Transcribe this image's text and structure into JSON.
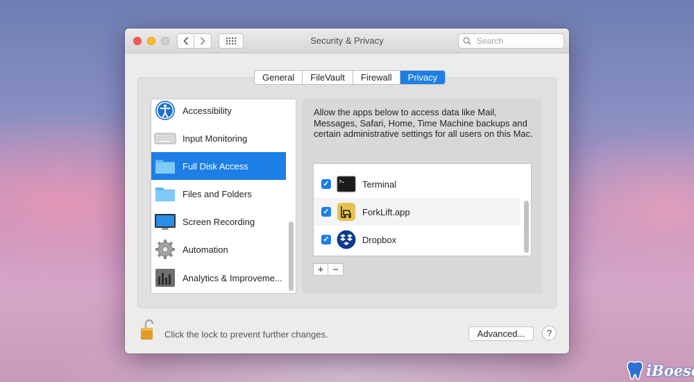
{
  "window": {
    "title": "Security & Privacy",
    "search_placeholder": "Search"
  },
  "tabs": [
    {
      "label": "General",
      "active": false
    },
    {
      "label": "FileVault",
      "active": false
    },
    {
      "label": "Firewall",
      "active": false
    },
    {
      "label": "Privacy",
      "active": true
    }
  ],
  "categories": [
    {
      "label": "Accessibility",
      "icon": "accessibility-icon"
    },
    {
      "label": "Input Monitoring",
      "icon": "keyboard-icon"
    },
    {
      "label": "Full Disk Access",
      "icon": "folder-icon",
      "selected": true
    },
    {
      "label": "Files and Folders",
      "icon": "folder-icon"
    },
    {
      "label": "Screen Recording",
      "icon": "display-icon"
    },
    {
      "label": "Automation",
      "icon": "gear-icon"
    },
    {
      "label": "Analytics & Improveme...",
      "icon": "analytics-icon"
    }
  ],
  "description": "Allow the apps below to access data like Mail, Messages, Safari, Home, Time Machine backups and certain administrative settings for all users on this Mac.",
  "apps": [
    {
      "name": "Terminal",
      "checked": true,
      "icon": "terminal-icon"
    },
    {
      "name": "ForkLift.app",
      "checked": true,
      "icon": "forklift-icon"
    },
    {
      "name": "Dropbox",
      "checked": true,
      "icon": "dropbox-icon"
    }
  ],
  "controls": {
    "add": "+",
    "remove": "−"
  },
  "footer": {
    "lock_text": "Click the lock to prevent further changes.",
    "advanced_label": "Advanced...",
    "help_label": "?"
  },
  "watermark": "iBoesoft",
  "colors": {
    "accent": "#1d7ee6",
    "close": "#fc5f57",
    "minimize": "#fdbb2e"
  }
}
